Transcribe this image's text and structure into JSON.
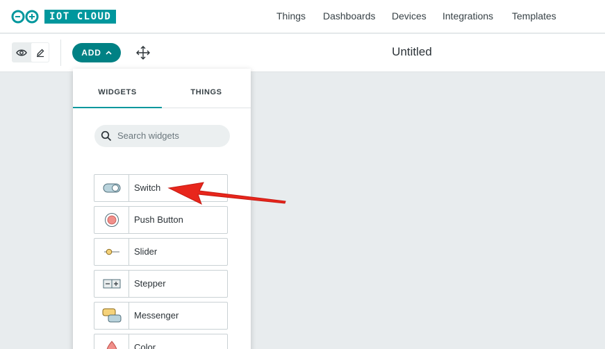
{
  "topnav": {
    "logo_text": "IOT CLOUD",
    "links": [
      {
        "label": "Things"
      },
      {
        "label": "Dashboards"
      },
      {
        "label": "Devices"
      },
      {
        "label": "Integrations"
      },
      {
        "label": "Templates"
      }
    ]
  },
  "toolbar": {
    "add_label": "ADD",
    "dashboard_title": "Untitled"
  },
  "panel": {
    "tabs": [
      {
        "label": "WIDGETS",
        "active": true
      },
      {
        "label": "THINGS",
        "active": false
      }
    ],
    "search_placeholder": "Search widgets",
    "widgets": [
      {
        "label": "Switch",
        "icon": "switch-icon"
      },
      {
        "label": "Push Button",
        "icon": "push-button-icon"
      },
      {
        "label": "Slider",
        "icon": "slider-icon"
      },
      {
        "label": "Stepper",
        "icon": "stepper-icon"
      },
      {
        "label": "Messenger",
        "icon": "messenger-icon"
      },
      {
        "label": "Color",
        "icon": "color-icon"
      }
    ]
  },
  "colors": {
    "accent": "#00979d",
    "add_button": "#008184",
    "annotation_arrow": "#e8261c"
  }
}
